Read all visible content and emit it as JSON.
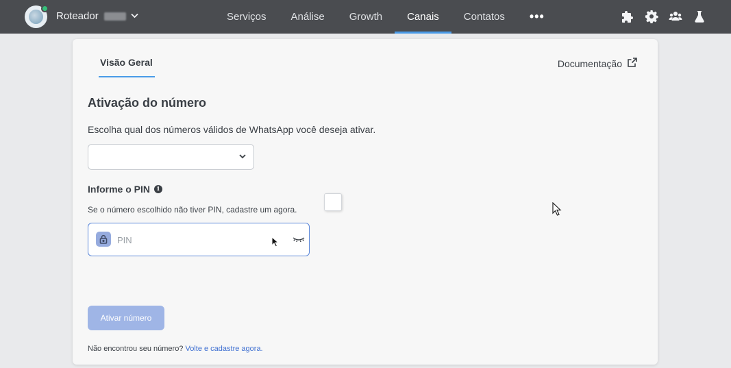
{
  "header": {
    "org_name": "Roteador",
    "nav": [
      {
        "label": "Serviços"
      },
      {
        "label": "Análise"
      },
      {
        "label": "Growth"
      },
      {
        "label": "Canais",
        "active": true
      },
      {
        "label": "Contatos"
      }
    ],
    "more_label": "•••",
    "icons": [
      "puzzle-icon",
      "gear-icon",
      "users-icon",
      "flask-icon"
    ],
    "accent_color": "#4a9be8",
    "status_color": "#35c07a"
  },
  "tabs": {
    "overview_label": "Visão Geral",
    "docs_label": "Documentação"
  },
  "activation": {
    "title": "Ativação do número",
    "description": "Escolha qual dos números válidos de WhatsApp você deseja ativar.",
    "select_value": ""
  },
  "pin": {
    "label": "Informe o PIN",
    "info_icon_glyph": "i",
    "hint": "Se o número escolhido não tiver PIN, cadastre um agora.",
    "placeholder": "PIN",
    "value": ""
  },
  "actions": {
    "activate_label": "Ativar número",
    "footer_text": "Não encontrou seu número? ",
    "footer_link": "Volte e cadastre agora."
  }
}
